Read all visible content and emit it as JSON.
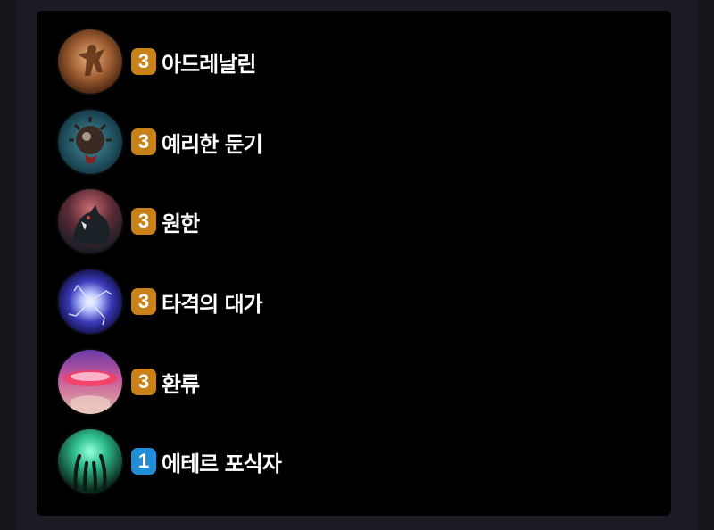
{
  "traits": [
    {
      "count": "3",
      "name": "아드레날린",
      "icon": "adrenaline-icon",
      "badge_color": "#c98217"
    },
    {
      "count": "3",
      "name": "예리한 둔기",
      "icon": "sharp-blunt-weapon-icon",
      "badge_color": "#c98217"
    },
    {
      "count": "3",
      "name": "원한",
      "icon": "grudge-icon",
      "badge_color": "#c98217"
    },
    {
      "count": "3",
      "name": "타격의 대가",
      "icon": "strike-master-icon",
      "badge_color": "#c98217"
    },
    {
      "count": "3",
      "name": "환류",
      "icon": "reflux-icon",
      "badge_color": "#c98217"
    },
    {
      "count": "1",
      "name": "에테르 포식자",
      "icon": "ether-devourer-icon",
      "badge_color": "#1f8ed6"
    }
  ]
}
